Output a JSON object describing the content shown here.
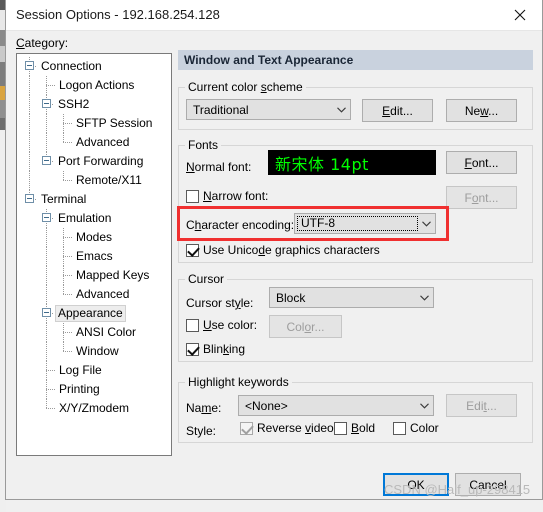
{
  "window": {
    "title": "Session Options - 192.168.254.128",
    "close_icon": "close-icon"
  },
  "category": {
    "label": "Category:",
    "tree": [
      {
        "label": "Connection",
        "depth": 0,
        "toggle": true,
        "selected": false
      },
      {
        "label": "Logon Actions",
        "depth": 1,
        "toggle": false,
        "selected": false
      },
      {
        "label": "SSH2",
        "depth": 1,
        "toggle": true,
        "selected": false
      },
      {
        "label": "SFTP Session",
        "depth": 2,
        "toggle": false,
        "selected": false
      },
      {
        "label": "Advanced",
        "depth": 2,
        "toggle": false,
        "selected": false
      },
      {
        "label": "Port Forwarding",
        "depth": 1,
        "toggle": true,
        "selected": false
      },
      {
        "label": "Remote/X11",
        "depth": 2,
        "toggle": false,
        "selected": false
      },
      {
        "label": "Terminal",
        "depth": 0,
        "toggle": true,
        "selected": false
      },
      {
        "label": "Emulation",
        "depth": 1,
        "toggle": true,
        "selected": false
      },
      {
        "label": "Modes",
        "depth": 2,
        "toggle": false,
        "selected": false
      },
      {
        "label": "Emacs",
        "depth": 2,
        "toggle": false,
        "selected": false
      },
      {
        "label": "Mapped Keys",
        "depth": 2,
        "toggle": false,
        "selected": false
      },
      {
        "label": "Advanced",
        "depth": 2,
        "toggle": false,
        "selected": false
      },
      {
        "label": "Appearance",
        "depth": 1,
        "toggle": true,
        "selected": true
      },
      {
        "label": "ANSI Color",
        "depth": 2,
        "toggle": false,
        "selected": false
      },
      {
        "label": "Window",
        "depth": 2,
        "toggle": false,
        "selected": false
      },
      {
        "label": "Log File",
        "depth": 1,
        "toggle": false,
        "selected": false
      },
      {
        "label": "Printing",
        "depth": 1,
        "toggle": false,
        "selected": false
      },
      {
        "label": "X/Y/Zmodem",
        "depth": 1,
        "toggle": false,
        "selected": false
      }
    ]
  },
  "pane": {
    "header": "Window and Text Appearance",
    "color_scheme": {
      "legend": "Current color scheme",
      "selected": "Traditional",
      "options": [
        "Traditional"
      ],
      "edit_label": "Edit...",
      "new_label": "New..."
    },
    "fonts": {
      "legend": "Fonts",
      "normal_font_label": "Normal font:",
      "normal_font_preview": "新宋体  14pt",
      "normal_font_button": "Font...",
      "narrow_font_label": "Narrow font:",
      "narrow_font_checked": false,
      "narrow_font_button": "Font...",
      "encoding_label": "Character encoding:",
      "encoding_value": "UTF-8",
      "encoding_options": [
        "UTF-8"
      ],
      "unicode_graphics_label": "Use Unicode graphics characters",
      "unicode_graphics_checked": true
    },
    "cursor": {
      "legend": "Cursor",
      "style_label": "Cursor style:",
      "style_value": "Block",
      "style_options": [
        "Block"
      ],
      "use_color_label": "Use color:",
      "use_color_checked": false,
      "color_button": "Color...",
      "blinking_label": "Blinking",
      "blinking_checked": true
    },
    "highlight": {
      "legend": "Highlight keywords",
      "name_label": "Name:",
      "name_value": "<None>",
      "name_options": [
        "<None>"
      ],
      "edit_button": "Edit...",
      "style_label": "Style:",
      "reverse_video_label": "Reverse video",
      "reverse_video_checked": true,
      "bold_label": "Bold",
      "bold_checked": false,
      "color_label": "Color",
      "color_checked": false
    }
  },
  "footer": {
    "ok_label": "OK",
    "cancel_label": "Cancel"
  },
  "annotation": {
    "highlight_target": "character-encoding-row",
    "color": "#f03030"
  },
  "watermark": {
    "text": "CSDN @Half_up-298415"
  }
}
